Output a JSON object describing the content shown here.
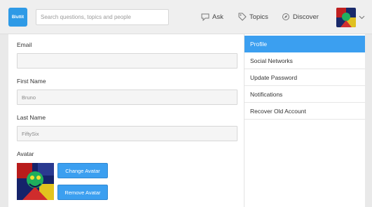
{
  "header": {
    "logo_text": "Bluttit",
    "search_placeholder": "Search questions, topics and people",
    "nav": [
      {
        "label": "Ask",
        "icon": "speech-bubble-icon"
      },
      {
        "label": "Topics",
        "icon": "tag-icon"
      },
      {
        "label": "Discover",
        "icon": "compass-icon"
      }
    ]
  },
  "form": {
    "email": {
      "label": "Email",
      "value": ""
    },
    "first_name": {
      "label": "First Name",
      "value": "Bruno"
    },
    "last_name": {
      "label": "Last Name",
      "value": "FiftySix"
    },
    "avatar": {
      "label": "Avatar",
      "change_label": "Change Avatar",
      "remove_label": "Remove Avatar"
    }
  },
  "sidebar": {
    "items": [
      {
        "label": "Profile",
        "active": true
      },
      {
        "label": "Social Networks",
        "active": false
      },
      {
        "label": "Update Password",
        "active": false
      },
      {
        "label": "Notifications",
        "active": false
      },
      {
        "label": "Recover Old Account",
        "active": false
      }
    ]
  },
  "colors": {
    "accent": "#3b9ff0",
    "background": "#e9e9e9"
  }
}
